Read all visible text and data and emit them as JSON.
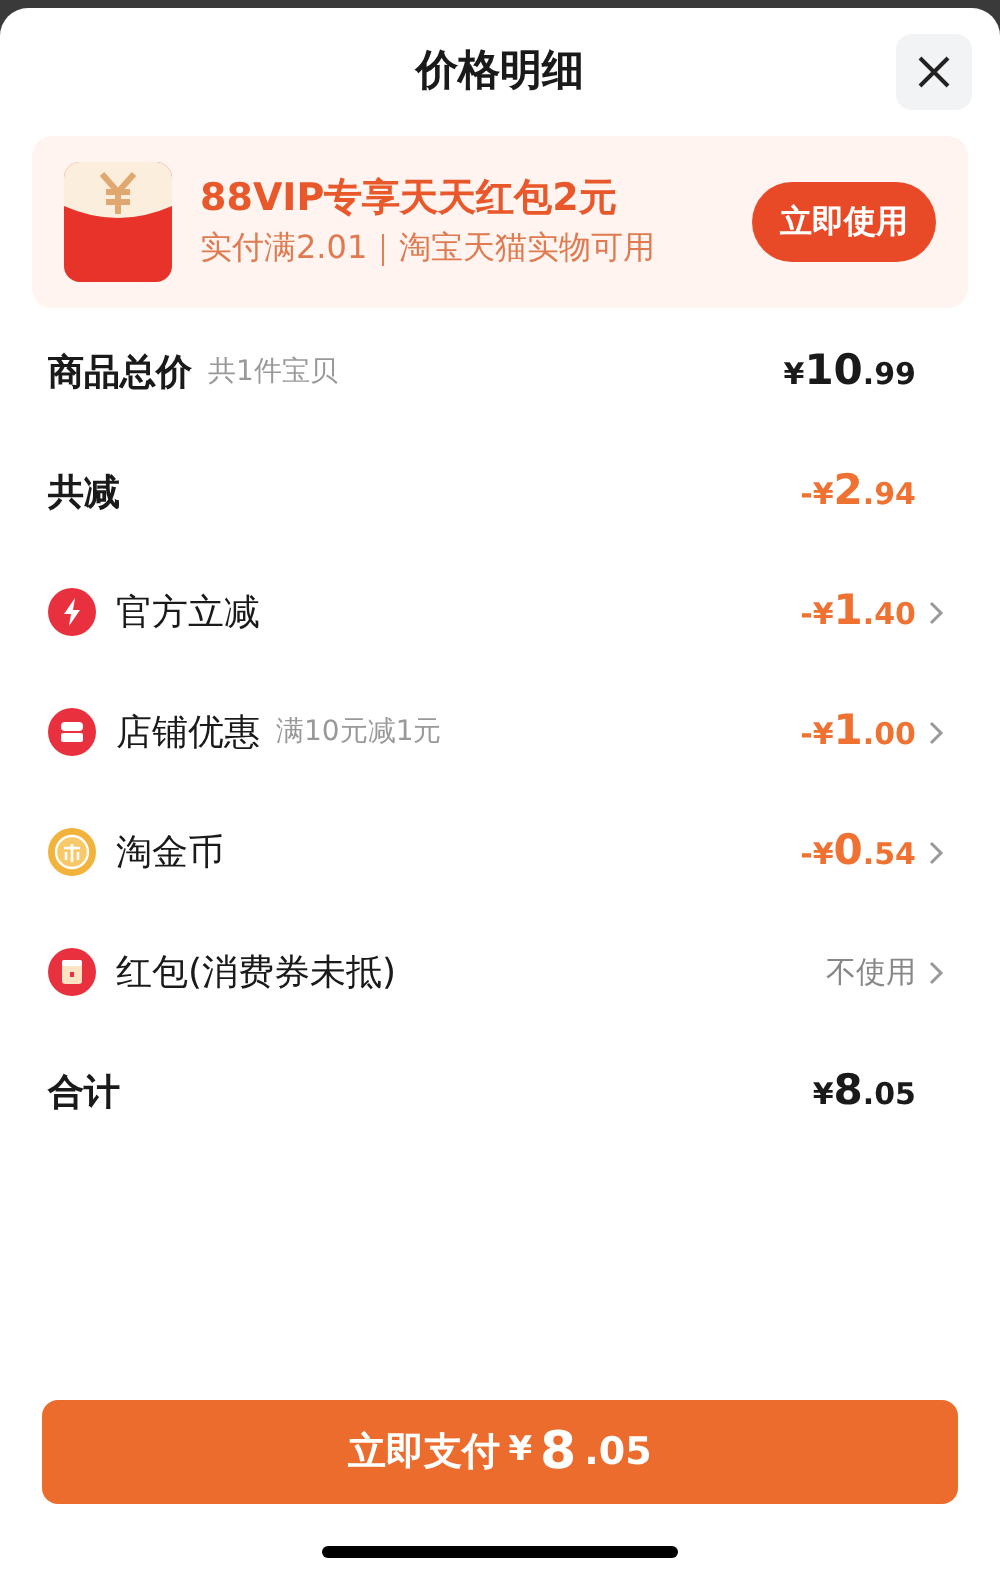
{
  "title": "价格明细",
  "banner": {
    "headline": "88VIP专享天天红包2元",
    "subline": "实付满2.01｜淘宝天猫实物可用",
    "button": "立即使用"
  },
  "rows": [
    {
      "kind": "summary",
      "label": "商品总价",
      "note": "共1件宝贝",
      "discount": false,
      "value": {
        "prefix": "¥",
        "whole": "10",
        "fraction": ".99"
      }
    },
    {
      "kind": "summary",
      "label": "共减",
      "discount": true,
      "value": {
        "prefix": "-¥",
        "whole": "2",
        "fraction": ".94"
      }
    },
    {
      "kind": "item",
      "label": "官方立减",
      "discount": true,
      "value": {
        "prefix": "-¥",
        "whole": "1",
        "fraction": ".40"
      }
    },
    {
      "kind": "item",
      "label": "店铺优惠",
      "note": "满10元减1元",
      "discount": true,
      "value": {
        "prefix": "-¥",
        "whole": "1",
        "fraction": ".00"
      }
    },
    {
      "kind": "item",
      "label": "淘金币",
      "discount": true,
      "value": {
        "prefix": "-¥",
        "whole": "0",
        "fraction": ".54"
      }
    },
    {
      "kind": "item",
      "label": "红包(消费券未抵)",
      "option": "不使用"
    },
    {
      "kind": "summary",
      "label": "合计",
      "discount": false,
      "value": {
        "prefix": "¥",
        "whole": "8",
        "fraction": ".05"
      }
    }
  ],
  "pay_button": {
    "label": "立即支付",
    "value": {
      "prefix": "¥",
      "whole": "8",
      "fraction": ".05"
    }
  }
}
